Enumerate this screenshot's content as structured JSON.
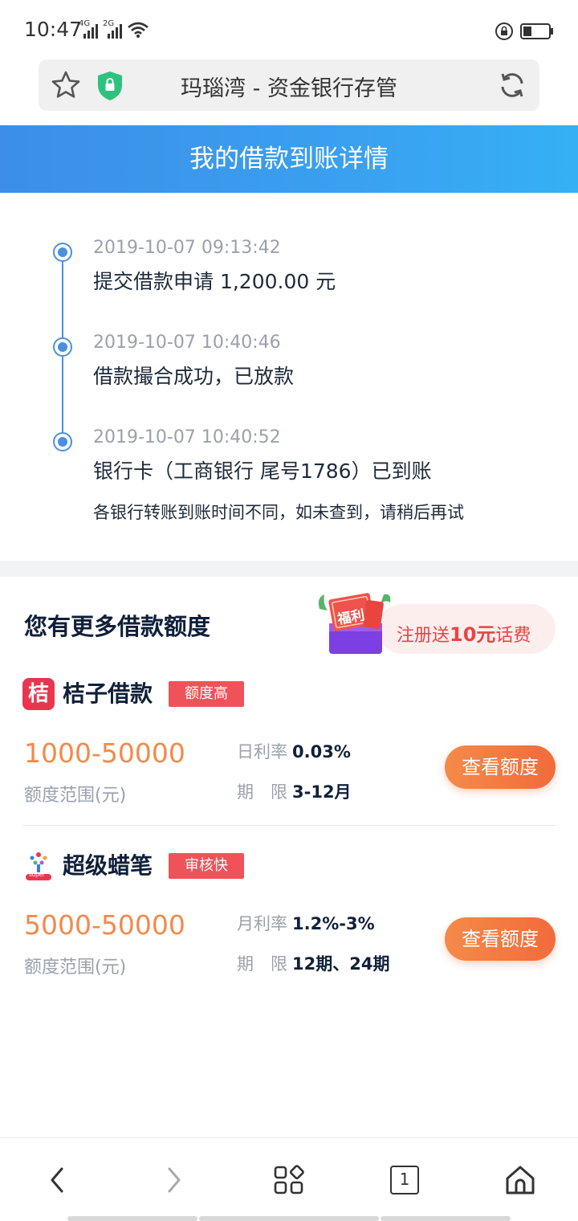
{
  "status_bar": {
    "time": "10:47",
    "net1": "4G",
    "net2": "2G"
  },
  "url_bar": {
    "title": "玛瑙湾 - 资金银行存管",
    "star_icon": "star-icon",
    "secure_icon": "shield-lock-icon",
    "refresh_icon": "refresh-icon"
  },
  "header": {
    "title": "我的借款到账详情"
  },
  "timeline": [
    {
      "time": "2019-10-07 09:13:42",
      "text": "提交借款申请 1,200.00 元"
    },
    {
      "time": "2019-10-07 10:40:46",
      "text": "借款撮合成功，已放款"
    },
    {
      "time": "2019-10-07 10:40:52",
      "text": "银行卡（工商银行 尾号1786）已到账"
    }
  ],
  "timeline_note": "各银行转账到账时间不同，如未查到，请稍后再试",
  "more_loans": {
    "title": "您有更多借款额度",
    "promo": {
      "gift_label": "福利",
      "text_prefix": "注册送",
      "text_amount": "10元",
      "text_suffix": "话费"
    },
    "items": [
      {
        "logo_char": "桔",
        "name": "桔子借款",
        "tag": "额度高",
        "range": "1000-50000",
        "range_label": "额度范围(元)",
        "rate_label": "日利率",
        "rate_value": "0.03%",
        "term_label": "期　限",
        "term_value": "3-12月",
        "button": "查看额度"
      },
      {
        "logo_char": "super",
        "name": "超级蜡笔",
        "tag": "审核快",
        "range": "5000-50000",
        "range_label": "额度范围(元)",
        "rate_label": "月利率",
        "rate_value": "1.2%-3%",
        "term_label": "期　限",
        "term_value": "12期、24期",
        "button": "查看额度"
      }
    ]
  },
  "bottom_nav": {
    "tab_count": "1",
    "icons": [
      "back-icon",
      "forward-icon",
      "apps-icon",
      "tabs-icon",
      "home-icon"
    ]
  },
  "colors": {
    "header_gradient_start": "#3c8ee6",
    "header_gradient_end": "#35b0f5",
    "timeline_accent": "#4a90e2",
    "range_orange": "#f28a4a",
    "tag_red": "#f0525a"
  }
}
